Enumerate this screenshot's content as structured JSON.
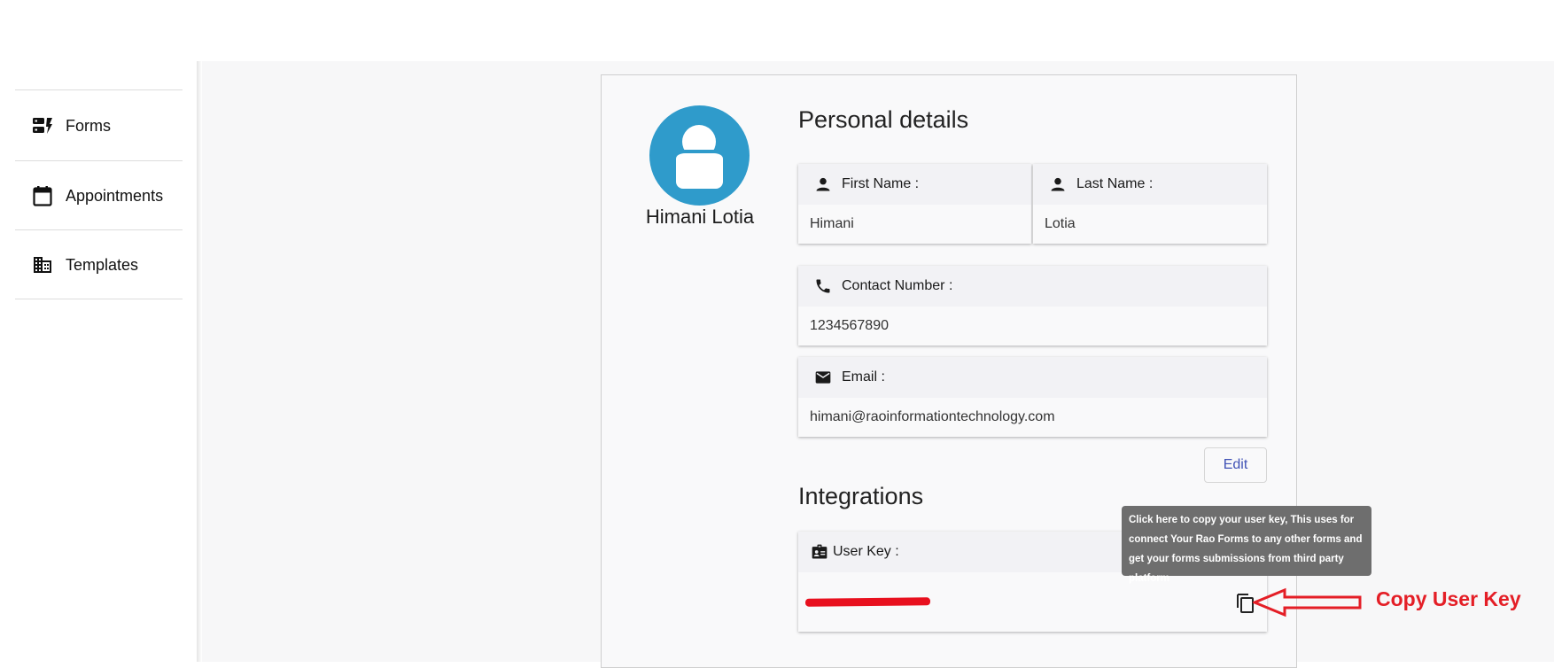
{
  "sidebar": {
    "items": [
      {
        "label": "Forms",
        "icon": "forms-icon"
      },
      {
        "label": "Appointments",
        "icon": "calendar-icon"
      },
      {
        "label": "Templates",
        "icon": "business-icon"
      }
    ]
  },
  "profile": {
    "name": "Himani Lotia",
    "avatar_color": "#2f9bcb"
  },
  "personal": {
    "title": "Personal details",
    "first_name_label": "First Name :",
    "first_name": "Himani",
    "last_name_label": "Last Name :",
    "last_name": "Lotia",
    "contact_label": "Contact Number :",
    "contact": "1234567890",
    "email_label": "Email :",
    "email": "himani@raoinformationtechnology.com",
    "edit_label": "Edit"
  },
  "integrations": {
    "title": "Integrations",
    "user_key_label": "User Key :",
    "user_key_value_redacted": true,
    "tooltip": "Click here to copy your user key, This uses for connect Your Rao Forms to any other forms and get your forms submissions from third party platform"
  },
  "annotation": {
    "label": "Copy User Key",
    "color": "#e41e26"
  },
  "colors": {
    "accent": "#3f51b5",
    "tooltip_bg": "#6e6e6e"
  }
}
